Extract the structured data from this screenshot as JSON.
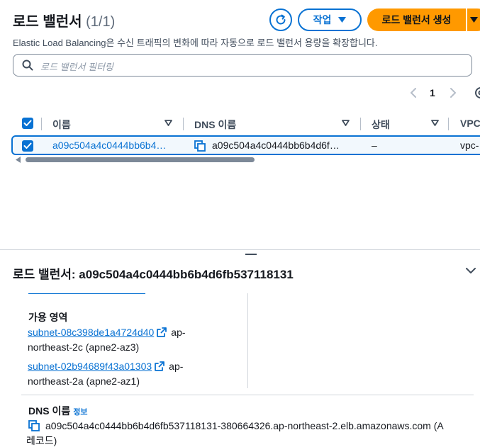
{
  "header": {
    "title": "로드 밸런서",
    "count": "(1/1)",
    "actions_label": "작업",
    "create_label": "로드 밸런서 생성",
    "description": "Elastic Load Balancing은 수신 트래픽의 변화에 따라 자동으로 로드 밸런서 용량을 확장합니다."
  },
  "filter": {
    "placeholder": "로드 밸런서 필터링"
  },
  "pagination": {
    "current_page": "1"
  },
  "table": {
    "columns": [
      "이름",
      "DNS 이름",
      "상태",
      "VPC"
    ],
    "rows": [
      {
        "name": "a09c504a4c0444bb6b4…",
        "dns": "a09c504a4c0444bb6b4d6f…",
        "status": "–",
        "vpc": "vpc-"
      }
    ]
  },
  "detail": {
    "title": "로드 밸런서: a09c504a4c0444bb6b4d6fb537118131",
    "az_label": "가용 영역",
    "subnets": [
      {
        "id": "subnet-08c398de1a4724d40",
        "az_line1": "ap-",
        "az_line2": "northeast-2c (apne2-az3)"
      },
      {
        "id": "subnet-02b94689f43a01303",
        "az_line1": "ap-",
        "az_line2": "northeast-2a (apne2-az1)"
      }
    ],
    "dns_label": "DNS 이름",
    "dns_info": "정보",
    "dns_value_line1": "a09c504a4c0444bb6b4d6fb537118131-380664326.ap-northeast-2.elb.amazonaws.com (A",
    "dns_value_line2": "레코드)"
  },
  "colors": {
    "primary": "#0972d3",
    "accent": "#ff9900",
    "text": "#16191f",
    "muted": "#414d5c"
  }
}
